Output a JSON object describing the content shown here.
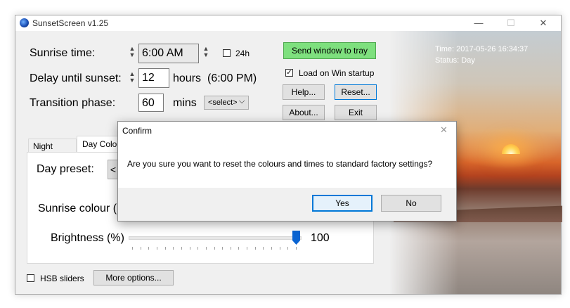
{
  "window": {
    "title": "SunsetScreen v1.25",
    "minimize_glyph": "—",
    "maximize_glyph": "☐",
    "close_glyph": "✕"
  },
  "settings": {
    "sunrise_label": "Sunrise time:",
    "sunrise_value": "6:00 AM",
    "checkbox_24h_label": "24h",
    "checkbox_24h_checked": false,
    "delay_label": "Delay until sunset:",
    "delay_value": "12",
    "delay_unit": "hours",
    "delay_result": "(6:00 PM)",
    "transition_label": "Transition phase:",
    "transition_value": "60",
    "transition_unit": "mins",
    "transition_select": "<select>"
  },
  "buttons": {
    "send_to_tray": "Send window to tray",
    "load_startup_label": "Load on Win startup",
    "load_startup_checked": true,
    "help": "Help...",
    "reset": "Reset...",
    "about": "About...",
    "exit": "Exit",
    "more_options": "More options..."
  },
  "status": {
    "time": "Time: 2017-05-26 16:34:37",
    "status": "Status: Day"
  },
  "tabs": {
    "night": "Night Colour",
    "day": "Day Colour"
  },
  "day_panel": {
    "preset_label": "Day preset:",
    "preset_value": "<",
    "sunrise_colour_label": "Sunrise colour (k",
    "brightness_label": "Brightness (%)",
    "brightness_value": "100",
    "brightness_fraction": 1.0
  },
  "hsb_label": "HSB sliders",
  "hsb_checked": false,
  "dialog": {
    "title": "Confirm",
    "message": "Are you sure you want to reset the colours and times to standard factory settings?",
    "yes": "Yes",
    "no": "No",
    "close_glyph": "✕"
  },
  "colors": {
    "tray_button_bg": "#7ee07e",
    "accent_blue": "#0a64d2"
  }
}
